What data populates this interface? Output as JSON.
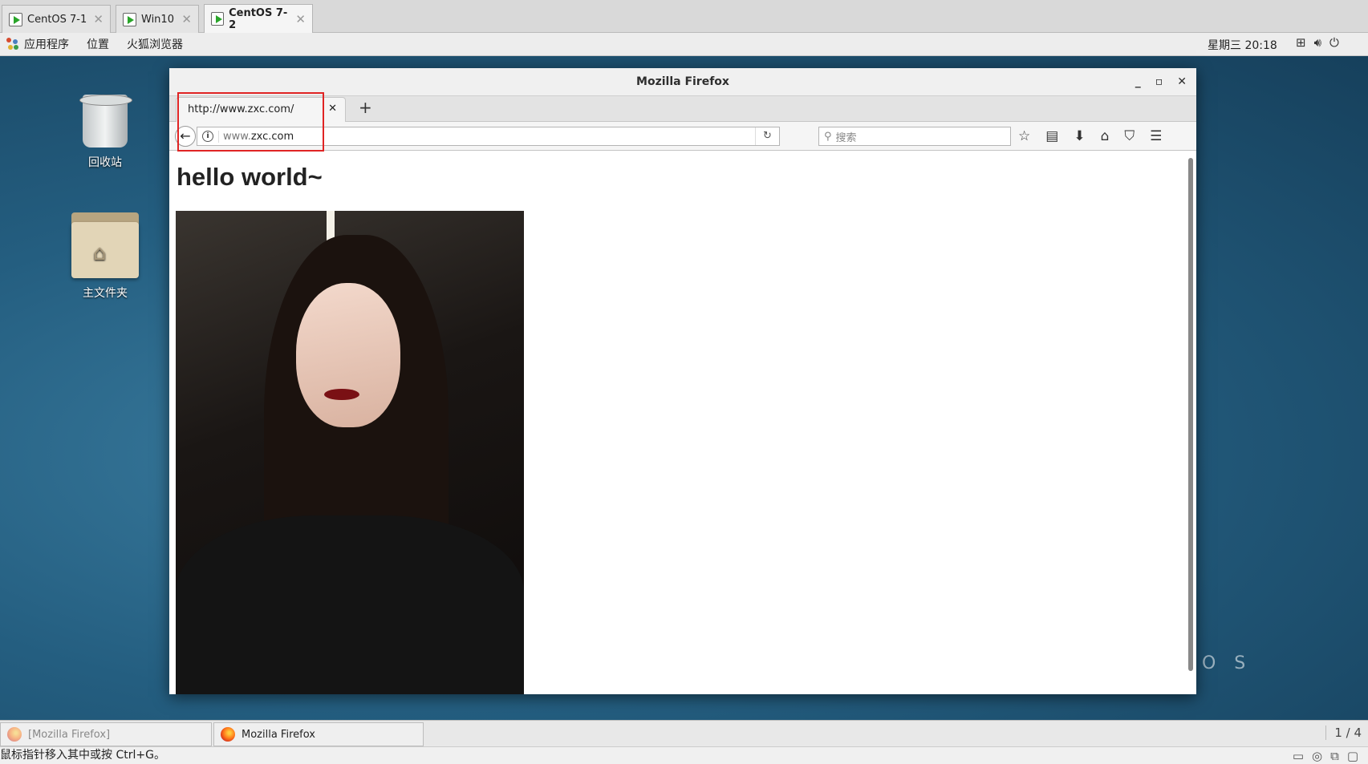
{
  "vm_tabs": [
    {
      "label": "CentOS 7-1",
      "active": false
    },
    {
      "label": "Win10",
      "active": false
    },
    {
      "label": "CentOS 7-2",
      "active": true
    }
  ],
  "gnome_panel": {
    "menus": [
      "应用程序",
      "位置",
      "火狐浏览器"
    ],
    "clock": "星期三 20:18"
  },
  "desktop": {
    "icons": [
      {
        "label": "回收站"
      },
      {
        "label": "主文件夹"
      }
    ],
    "watermark": "O S"
  },
  "firefox": {
    "window_title": "Mozilla Firefox",
    "tab_title": "http://www.zxc.com/",
    "url_prefix": "www.",
    "url_domain": "zxc.com",
    "search_placeholder": "搜索",
    "page_heading": "hello world~"
  },
  "taskbar": {
    "tasks": [
      {
        "label": "[Mozilla Firefox]",
        "active": false
      },
      {
        "label": "Mozilla Firefox",
        "active": true
      }
    ],
    "pager": "1 / 4"
  },
  "host_status": "鼠标指针移入其中或按 Ctrl+G。",
  "colors": {
    "highlight_box": "#e02424",
    "desktop_bg": "#245e80"
  }
}
